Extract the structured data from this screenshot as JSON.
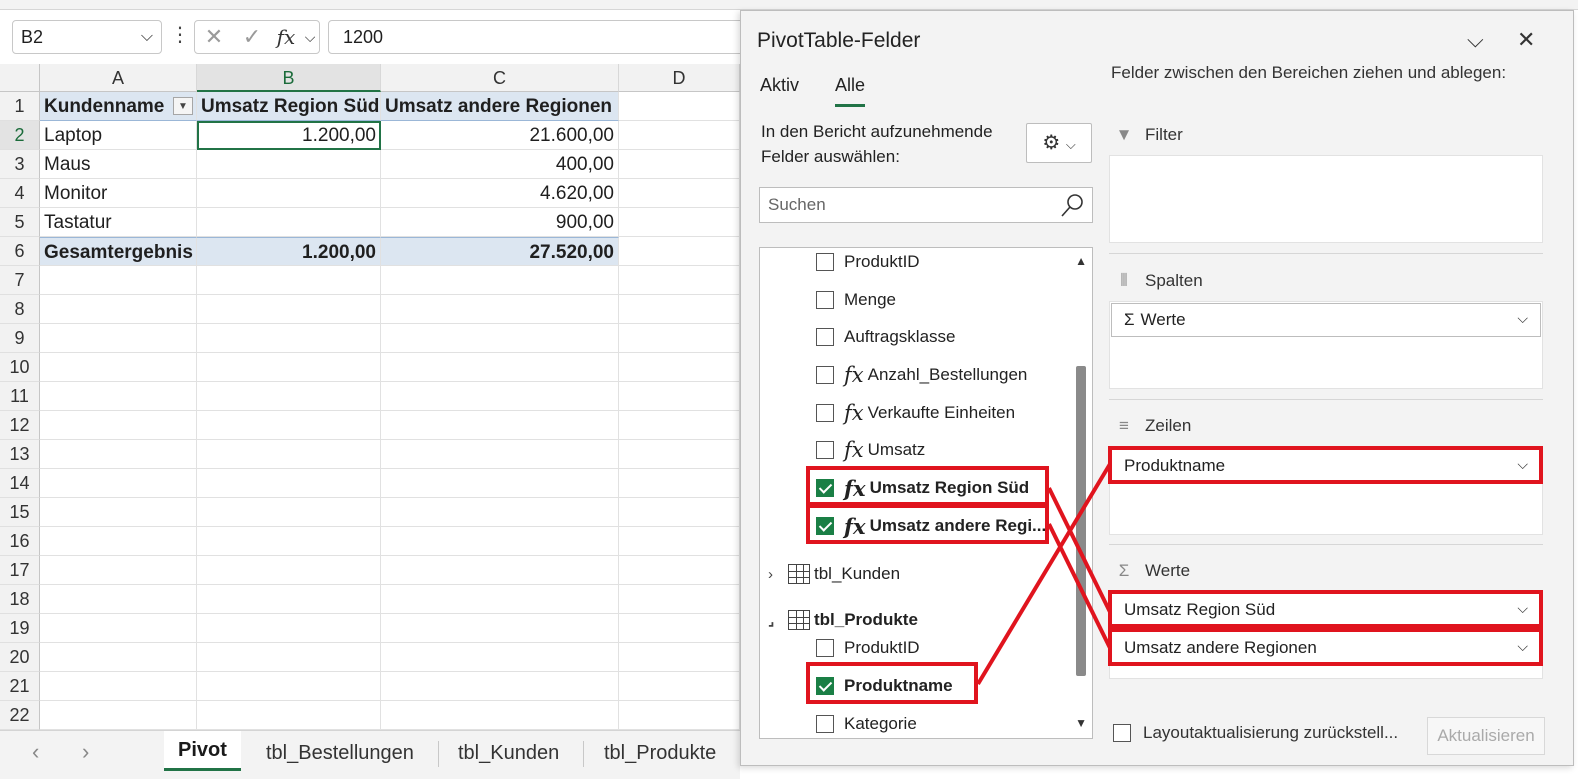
{
  "formula_bar": {
    "name_box": "B2",
    "dots": "⋮",
    "cancel_glyph": "✕",
    "enter_glyph": "✓",
    "fx_label": "fx",
    "value": "1200"
  },
  "grid": {
    "columns": [
      "A",
      "B",
      "C",
      "D"
    ],
    "rows": [
      "1",
      "2",
      "3",
      "4",
      "5",
      "6",
      "7",
      "8",
      "9",
      "10",
      "11",
      "12",
      "13",
      "14",
      "15",
      "16",
      "17",
      "18",
      "19",
      "20",
      "21",
      "22"
    ],
    "header": [
      "Kundenname",
      "Umsatz Region Süd",
      "Umsatz andere Regionen"
    ],
    "data": [
      [
        "Laptop",
        "1.200,00",
        "21.600,00"
      ],
      [
        "Maus",
        "",
        "400,00"
      ],
      [
        "Monitor",
        "",
        "4.620,00"
      ],
      [
        "Tastatur",
        "",
        "900,00"
      ]
    ],
    "total": [
      "Gesamtergebnis",
      "1.200,00",
      "27.520,00"
    ]
  },
  "sheet_tabs": [
    "Pivot",
    "tbl_Bestellungen",
    "tbl_Kunden",
    "tbl_Produkte"
  ],
  "pivot_panel": {
    "title": "PivotTable-Felder",
    "tabs": [
      "Aktiv",
      "Alle"
    ],
    "description": "In den Bericht aufzunehmende Felder auswählen:",
    "search_placeholder": "Suchen",
    "fields": [
      {
        "label": "ProduktID",
        "checked": false
      },
      {
        "label": "Menge",
        "checked": false
      },
      {
        "label": "Auftragsklasse",
        "checked": false
      },
      {
        "label": "Anzahl_Bestellungen",
        "checked": false,
        "calc": true
      },
      {
        "label": "Verkaufte Einheiten",
        "checked": false,
        "calc": true
      },
      {
        "label": "Umsatz",
        "checked": false,
        "calc": true
      },
      {
        "label": "Umsatz Region Süd",
        "checked": true,
        "calc": true
      },
      {
        "label": "Umsatz andere Regi...",
        "checked": true,
        "calc": true
      }
    ],
    "tables": [
      "tbl_Kunden",
      "tbl_Produkte"
    ],
    "produkt_fields": [
      {
        "label": "ProduktID",
        "checked": false
      },
      {
        "label": "Produktname",
        "checked": true
      },
      {
        "label": "Kategorie",
        "checked": false
      }
    ],
    "areas_heading": "Felder zwischen den Bereichen ziehen und ablegen:",
    "areas": {
      "filter": "Filter",
      "columns": "Spalten",
      "rows": "Zeilen",
      "values": "Werte"
    },
    "columns_chip": "Werte",
    "rows_chip": "Produktname",
    "values_chips": [
      "Umsatz Region Süd",
      "Umsatz andere Regionen"
    ],
    "defer_label": "Layoutaktualisierung zurückstell...",
    "update_button": "Aktualisieren"
  },
  "colors": {
    "accent_green": "#217346",
    "checkbox_green": "#1a7f45",
    "pivot_header_fill": "#dce6f1",
    "annotation_red": "#e0141e"
  }
}
